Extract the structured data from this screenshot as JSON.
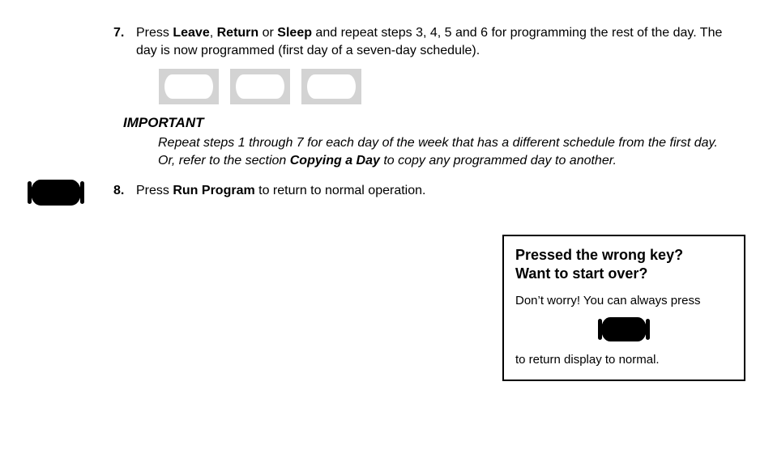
{
  "step7": {
    "number": "7.",
    "t1": "Press ",
    "b1": "Leave",
    "t2": ", ",
    "b2": "Return",
    "t3": " or ",
    "b3": "Sleep",
    "t4": " and repeat steps 3, 4, 5 and 6 for programming the rest of the day. The day is now programmed (first day of a seven-day schedule)."
  },
  "important": {
    "heading": "IMPORTANT",
    "t1": "Repeat steps 1 through 7 for each day of the week that has a different schedule from the first day. Or, refer to the section ",
    "b1": "Copying a Day",
    "t2": " to copy any programmed day to another."
  },
  "step8": {
    "number": "8.",
    "t1": "Press ",
    "b1": "Run Program",
    "t2": " to return to normal operation."
  },
  "callout": {
    "head_line1": "Pressed the wrong key?",
    "head_line2": "Want to start over?",
    "body1": "Don’t worry! You can always press",
    "body2": "to return display to normal."
  }
}
